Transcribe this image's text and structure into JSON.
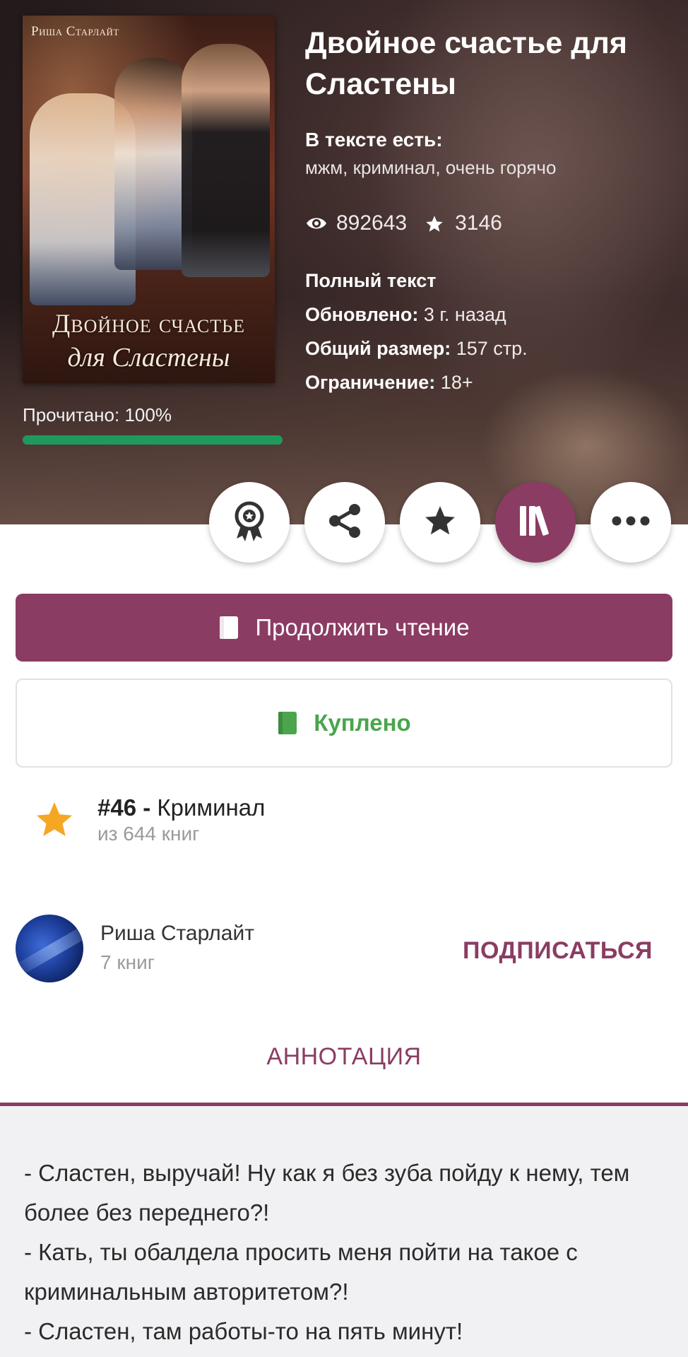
{
  "cover": {
    "author": "Риша Старлайт",
    "title_line1": "Двойное счастье",
    "title_line2": "для Сластены"
  },
  "progress": {
    "label": "Прочитано: 100%",
    "fraction": 1.0,
    "color": "#1f9a5f"
  },
  "book": {
    "title": "Двойное счастье для Сластены",
    "tags_label": "В тексте есть:",
    "tags": "мжм, криминал, очень горячо",
    "views": "892643",
    "stars": "3146",
    "status": "Полный текст",
    "updated_label": "Обновлено:",
    "updated_value": "3 г. назад",
    "size_label": "Общий размер:",
    "size_value": "157 стр.",
    "limit_label": "Ограничение:",
    "limit_value": "18+"
  },
  "actions": [
    {
      "icon": "award-icon"
    },
    {
      "icon": "share-icon"
    },
    {
      "icon": "star-icon"
    },
    {
      "icon": "library-icon",
      "active": true
    },
    {
      "icon": "more-icon"
    }
  ],
  "buttons": {
    "continue_label": "Продолжить чтение",
    "bought_label": "Куплено"
  },
  "rank": {
    "position": "#46",
    "separator": " - ",
    "genre": "Криминал",
    "of_total": "из 644 книг"
  },
  "author": {
    "name": "Риша Старлайт",
    "books": "7 книг",
    "subscribe_label": "ПОДПИСАТЬСЯ"
  },
  "annotation": {
    "tab_label": "АННОТАЦИЯ",
    "lines": [
      "- Сластен, выручай! Ну как я без зуба пойду к нему, тем более без переднего?!",
      "- Кать, ты обалдела просить меня пойти на такое с криминальным авторитетом?!",
      "- Сластен, там работы-то на пять минут!"
    ]
  },
  "colors": {
    "accent": "#8b3c63",
    "bought_green": "#4aa54d",
    "rank_star": "#f5a623"
  }
}
